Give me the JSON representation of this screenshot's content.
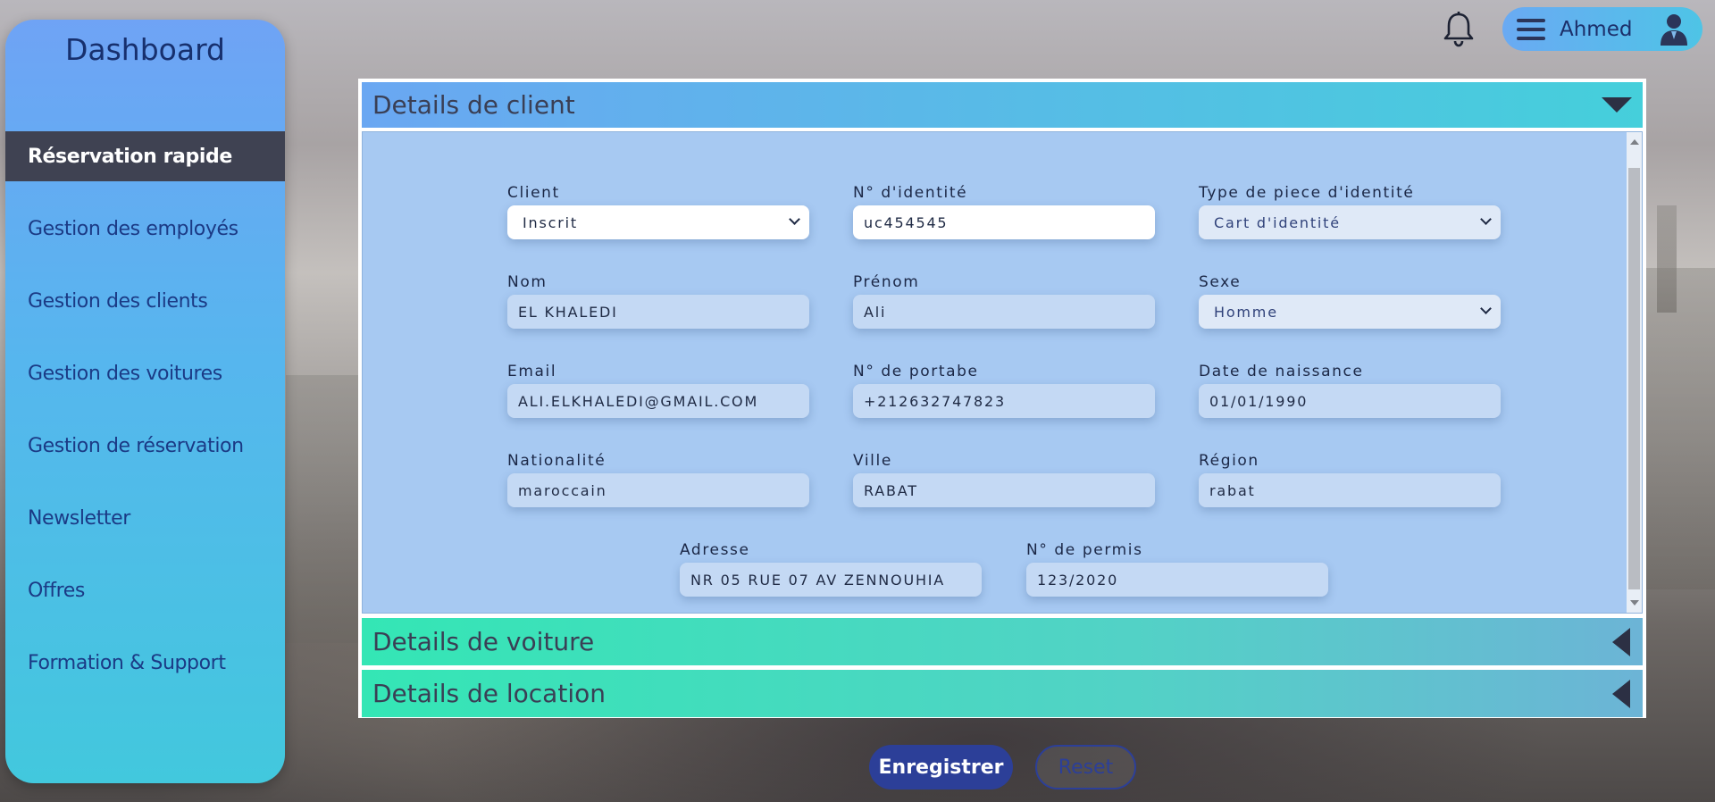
{
  "sidebar": {
    "title": "Dashboard",
    "items": [
      {
        "label": "Réservation rapide",
        "active": true
      },
      {
        "label": "Gestion des employés"
      },
      {
        "label": "Gestion des clients"
      },
      {
        "label": "Gestion des voitures"
      },
      {
        "label": "Gestion de réservation"
      },
      {
        "label": "Newsletter"
      },
      {
        "label": "Offres"
      },
      {
        "label": "Formation & Support"
      }
    ]
  },
  "header": {
    "user_name": "Ahmed",
    "icons": [
      "bell-icon",
      "hamburger-icon",
      "user-avatar-icon"
    ]
  },
  "sections": {
    "client": {
      "title": "Details de client",
      "expanded": true
    },
    "voiture": {
      "title": "Details de voiture",
      "expanded": false
    },
    "location": {
      "title": "Details de location",
      "expanded": false
    }
  },
  "form": {
    "client": {
      "label": "Client",
      "value": "Inscrit"
    },
    "identite": {
      "label": "N° d'identité",
      "value": "uc454545"
    },
    "type_piece": {
      "label": "Type de piece d'identité",
      "value": "Cart d'identité"
    },
    "nom": {
      "label": "Nom",
      "value": "EL KHALEDI"
    },
    "prenom": {
      "label": "Prénom",
      "value": "Ali"
    },
    "sexe": {
      "label": "Sexe",
      "value": "Homme"
    },
    "email": {
      "label": "Email",
      "value": "ALI.ELKHALEDI@GMAIL.COM"
    },
    "portable": {
      "label": "N° de portabe",
      "value": "+212632747823"
    },
    "naissance": {
      "label": "Date de naissance",
      "value": "01/01/1990"
    },
    "nationalite": {
      "label": "Nationalité",
      "value": "maroccain"
    },
    "ville": {
      "label": "Ville",
      "value": "RABAT"
    },
    "region": {
      "label": "Région",
      "value": "rabat"
    },
    "adresse": {
      "label": "Adresse",
      "value": "NR 05 RUE 07 AV ZENNOUHIA"
    },
    "permis": {
      "label": "N° de permis",
      "value": "123/2020"
    }
  },
  "actions": {
    "save_label": "Enregistrer",
    "reset_label": "Reset"
  },
  "colors": {
    "accent": "#2c3f98",
    "sidebar_active": "#3f4252",
    "form_bg": "#a7c9f2"
  }
}
